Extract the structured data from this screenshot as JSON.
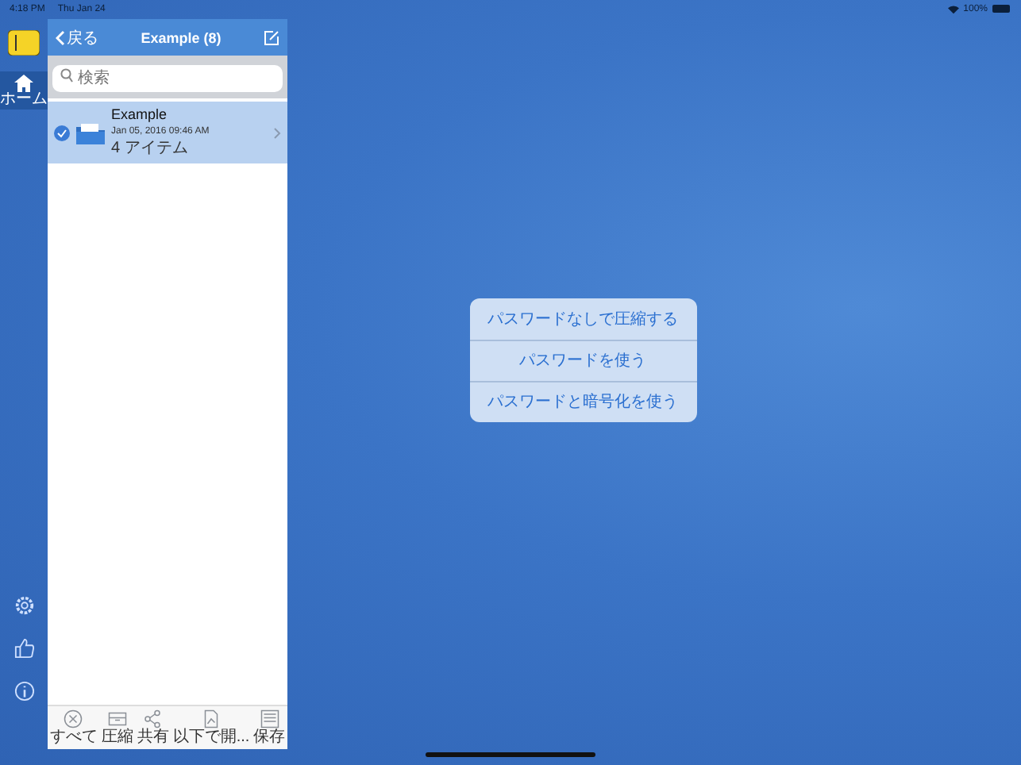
{
  "status_bar": {
    "time": "4:18 PM",
    "date": "Thu Jan 24",
    "battery": "100%"
  },
  "sidebar": {
    "items": [
      {
        "label": "ホーム",
        "selected": true
      }
    ]
  },
  "panel": {
    "back": "戻る",
    "title": "Example (8)",
    "search": {
      "placeholder": "検索"
    },
    "files": [
      {
        "name": "Example",
        "date": "Jan 05, 2016 09:46 AM",
        "count": "4 アイテム",
        "selected": true
      }
    ],
    "toolbar": [
      {
        "kind": "cancel",
        "label": "すべて"
      },
      {
        "kind": "compress",
        "label": "圧縮"
      },
      {
        "kind": "share",
        "label": "共有"
      },
      {
        "kind": "open",
        "label": "以下で開..."
      },
      {
        "kind": "save",
        "label": "保存"
      }
    ]
  },
  "popover": {
    "options": [
      "パスワードなしで圧縮する",
      "パスワードを使う",
      "パスワードと暗号化を使う"
    ]
  }
}
